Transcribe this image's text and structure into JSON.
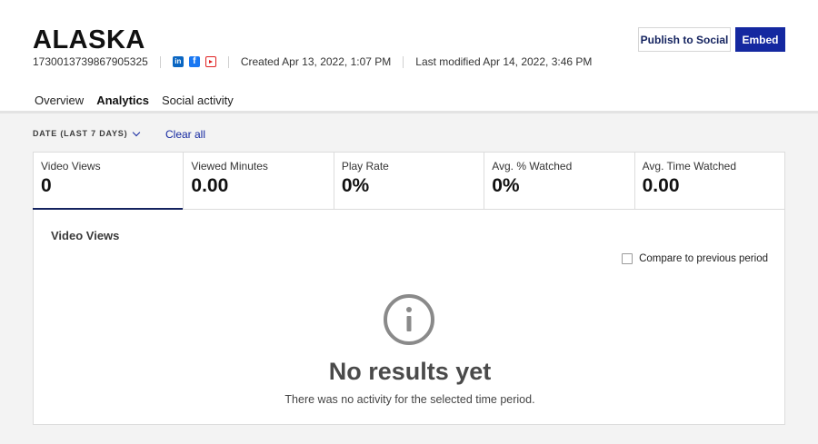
{
  "header": {
    "title": "ALASKA",
    "id": "1730013739867905325",
    "social_icons": [
      "linkedin-icon",
      "facebook-icon",
      "youtube-icon"
    ],
    "created": "Created Apr 13, 2022, 1:07 PM",
    "modified": "Last modified Apr 14, 2022, 3:46 PM",
    "publish_label": "Publish to Social",
    "embed_label": "Embed"
  },
  "tabs": [
    {
      "label": "Overview",
      "active": false
    },
    {
      "label": "Analytics",
      "active": true
    },
    {
      "label": "Social activity",
      "active": false
    }
  ],
  "filters": {
    "date_label": "DATE (LAST 7 DAYS)",
    "clear_label": "Clear all"
  },
  "metrics": [
    {
      "label": "Video Views",
      "value": "0",
      "active": true
    },
    {
      "label": "Viewed Minutes",
      "value": "0.00",
      "active": false
    },
    {
      "label": "Play Rate",
      "value": "0%",
      "active": false
    },
    {
      "label": "Avg. % Watched",
      "value": "0%",
      "active": false
    },
    {
      "label": "Avg. Time Watched",
      "value": "0.00",
      "active": false
    }
  ],
  "panel": {
    "title": "Video Views",
    "compare_label": "Compare to previous period",
    "compare_checked": false,
    "empty_title": "No results yet",
    "empty_sub": "There was no activity for the selected time period."
  },
  "colors": {
    "accent": "#1428a0",
    "navy_text": "#14235f",
    "linkedin": "#0a66c2",
    "facebook": "#1877f2",
    "youtube": "#e02020"
  }
}
